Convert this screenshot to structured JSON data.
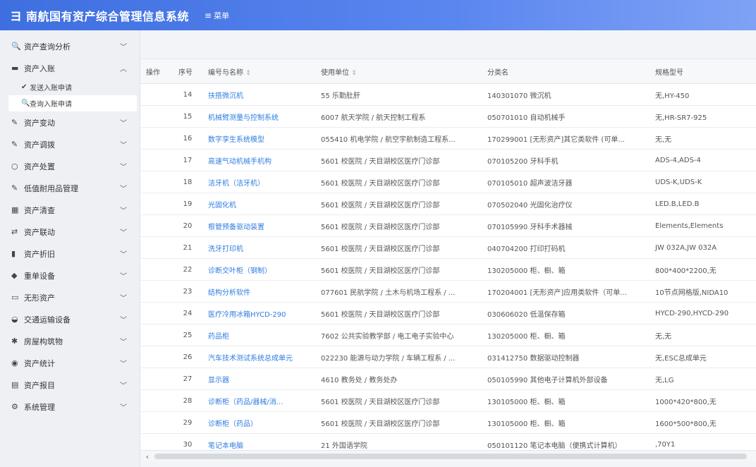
{
  "header": {
    "logo_glyph": "ヨ",
    "title": "南航国有资产综合管理信息系统",
    "menu_icon": "≡",
    "menu_label": "菜单"
  },
  "sidebar": {
    "items": [
      {
        "icon": "search",
        "glyph": "🔍",
        "label": "资产查询分析",
        "chevron": "v"
      },
      {
        "icon": "folder",
        "glyph": "▬",
        "label": "资产入账",
        "chevron": "^"
      },
      {
        "icon": "wrench",
        "glyph": "✎",
        "label": "资产变动",
        "chevron": "v"
      },
      {
        "icon": "pencil",
        "glyph": "✎",
        "label": "资产调拨",
        "chevron": "v"
      },
      {
        "icon": "circle",
        "glyph": "○",
        "label": "资产处置",
        "chevron": "v"
      },
      {
        "icon": "tool",
        "glyph": "✎",
        "label": "低值耐用品管理",
        "chevron": "v"
      },
      {
        "icon": "grid",
        "glyph": "▦",
        "label": "资产清查",
        "chevron": "v"
      },
      {
        "icon": "exchange",
        "glyph": "⇄",
        "label": "资产联动",
        "chevron": "v"
      },
      {
        "icon": "book",
        "glyph": "▮",
        "label": "资产折旧",
        "chevron": "v"
      },
      {
        "icon": "device",
        "glyph": "◆",
        "label": "重单设备",
        "chevron": "v"
      },
      {
        "icon": "monitor",
        "glyph": "▭",
        "label": "无形资产",
        "chevron": "v"
      },
      {
        "icon": "car",
        "glyph": "◒",
        "label": "交通运输设备",
        "chevron": "v"
      },
      {
        "icon": "building",
        "glyph": "✱",
        "label": "房屋构筑物",
        "chevron": "v"
      },
      {
        "icon": "chart",
        "glyph": "◉",
        "label": "资产统计",
        "chevron": "v"
      },
      {
        "icon": "card",
        "glyph": "▤",
        "label": "资产报目",
        "chevron": "v"
      },
      {
        "icon": "gear",
        "glyph": "⚙",
        "label": "系统管理",
        "chevron": "v"
      }
    ],
    "sub_items": [
      {
        "icon": "check",
        "glyph": "✔",
        "label": "发送入账申请"
      },
      {
        "icon": "search",
        "glyph": "🔍",
        "label": "查询入账申请"
      }
    ]
  },
  "table": {
    "headers": [
      "操作",
      "序号",
      "编号与名称",
      "使用单位",
      "分类名",
      "规格型号"
    ],
    "rows": [
      {
        "seq": "14",
        "name": "扶搭微沉机",
        "unit": "55 乐勤肚肝",
        "category": "140301070 微沉机",
        "spec": "无,HY-450"
      },
      {
        "seq": "15",
        "name": "机械臂测量与控制系统",
        "unit": "6007 航天学院 / 航天控制工程系",
        "category": "050701010 自动机械手",
        "spec": "无,HR-SR7-925"
      },
      {
        "seq": "16",
        "name": "数字孪生系统模型",
        "unit": "055410 机电学院 / 航空宇航制造工程系...",
        "category": "170299001 [无形资产]其它类软件 (可单...",
        "spec": "无,无"
      },
      {
        "seq": "17",
        "name": "高速气动机械手机构",
        "unit": "5601 校医院 / 天目湖校区医疗门诊部",
        "category": "070105200 牙科手机",
        "spec": "ADS-4,ADS-4"
      },
      {
        "seq": "18",
        "name": "洁牙机（洁牙机）",
        "unit": "5601 校医院 / 天目湖校区医疗门诊部",
        "category": "070105010 超声波洁牙器",
        "spec": "UDS-K,UDS-K"
      },
      {
        "seq": "19",
        "name": "光固化机",
        "unit": "5601 校医院 / 天目湖校区医疗门诊部",
        "category": "070502040 光固化治疗仪",
        "spec": "LED.B,LED.B"
      },
      {
        "seq": "20",
        "name": "根管预备驱动装置",
        "unit": "5601 校医院 / 天目湖校区医疗门诊部",
        "category": "070105990 牙科手术器械",
        "spec": "Elements,Elements"
      },
      {
        "seq": "21",
        "name": "洗牙打印机",
        "unit": "5601 校医院 / 天目湖校区医疗门诊部",
        "category": "040704200 打印打码机",
        "spec": "JW 032A,JW 032A"
      },
      {
        "seq": "22",
        "name": "诊断交叶柜（钢制）",
        "unit": "5601 校医院 / 天目湖校区医疗门诊部",
        "category": "130205000 柜、橱、箱",
        "spec": "800*400*2200,无"
      },
      {
        "seq": "23",
        "name": "结构分析软件",
        "unit": "077601 民航学院 / 土木与机场工程系 / ...",
        "category": "170204001 [无形资产]应用类软件（可单...",
        "spec": "10节点网格版,NIDA10"
      },
      {
        "seq": "24",
        "name": "医疗冷用冰箱HYCD-290",
        "unit": "5601 校医院 / 天目湖校区医疗门诊部",
        "category": "030606020 低温保存箱",
        "spec": "HYCD-290,HYCD-290"
      },
      {
        "seq": "25",
        "name": "药品柜",
        "unit": "7602 公共实验教学部 / 电工电子实验中心",
        "category": "130205000 柜、橱、箱",
        "spec": "无,无"
      },
      {
        "seq": "26",
        "name": "汽车技术测试系统总成单元",
        "unit": "022230 能源与动力学院 / 车辆工程系 / ...",
        "category": "031412750 数据驱动控制器",
        "spec": "无,ESC总成单元"
      },
      {
        "seq": "27",
        "name": "显示器",
        "unit": "4610 教务处 / 教务处办",
        "category": "050105990 其他电子计算机外部设备",
        "spec": "无,LG"
      },
      {
        "seq": "28",
        "name": "诊断柜（药品/器械/消...",
        "unit": "5601 校医院 / 天目湖校区医疗门诊部",
        "category": "130105000 柜、橱、箱",
        "spec": "1000*420*800,无"
      },
      {
        "seq": "29",
        "name": "诊断柜（药品）",
        "unit": "5601 校医院 / 天目湖校区医疗门诊部",
        "category": "130105000 柜、橱、箱",
        "spec": "1600*500*800,无"
      },
      {
        "seq": "30",
        "name": "笔记本电脑",
        "unit": "21 外国语学院",
        "category": "050101120 笔记本电脑（便携式计算机）",
        "spec": ",70Y1"
      }
    ]
  },
  "scrollbar": {
    "left_arrow": "‹"
  }
}
